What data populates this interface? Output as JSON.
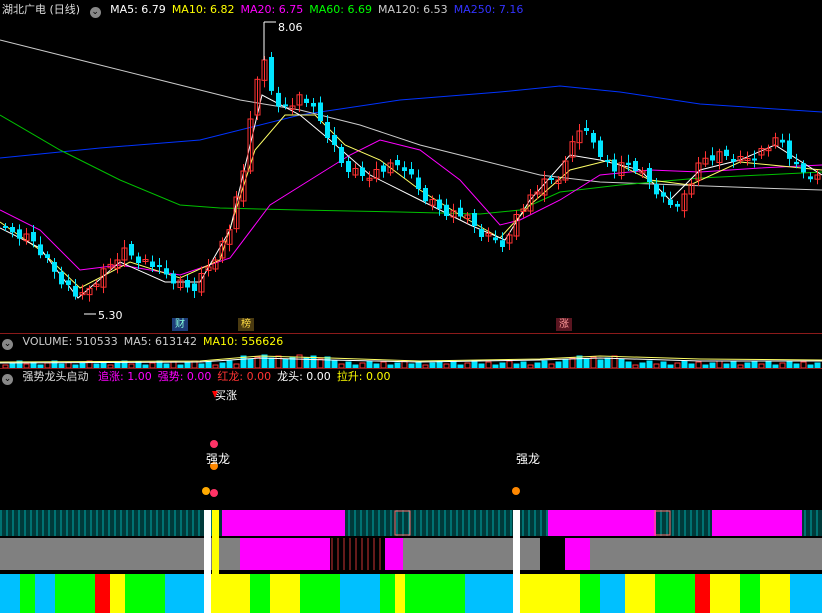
{
  "main_panel": {
    "stock_name": "湖北广电 (日线)",
    "ma_labels": [
      {
        "text": "MA5: 6.79",
        "color": "#ffffff"
      },
      {
        "text": "MA10: 6.82",
        "color": "#ffff00"
      },
      {
        "text": "MA20: 6.75",
        "color": "#ff00ff"
      },
      {
        "text": "MA60: 6.69",
        "color": "#00ff00"
      },
      {
        "text": "MA120: 6.53",
        "color": "#cccccc"
      },
      {
        "text": "MA250: 7.16",
        "color": "#3333ff"
      }
    ],
    "high_label": "8.06",
    "low_label": "5.30",
    "event_tags": [
      "财",
      "榜",
      "涨"
    ]
  },
  "volume_panel": {
    "labels": [
      {
        "text": "VOLUME: 510533",
        "color": "#cccccc"
      },
      {
        "text": "MA5: 613142",
        "color": "#cccccc"
      },
      {
        "text": "MA10: 556626",
        "color": "#ffff00"
      }
    ]
  },
  "indicator_panel": {
    "title": "强势龙头启动",
    "labels": [
      {
        "text": "追涨: 1.00",
        "color": "#ff00ff"
      },
      {
        "text": "强势: 0.00",
        "color": "#ff00ff"
      },
      {
        "text": "红龙: 0.00",
        "color": "#ff3333"
      },
      {
        "text": "龙头: 0.00",
        "color": "#ffffff"
      },
      {
        "text": "拉升: 0.00",
        "color": "#ffff00"
      }
    ],
    "buy_label": "买涨",
    "signal_label": "强龙"
  }
}
